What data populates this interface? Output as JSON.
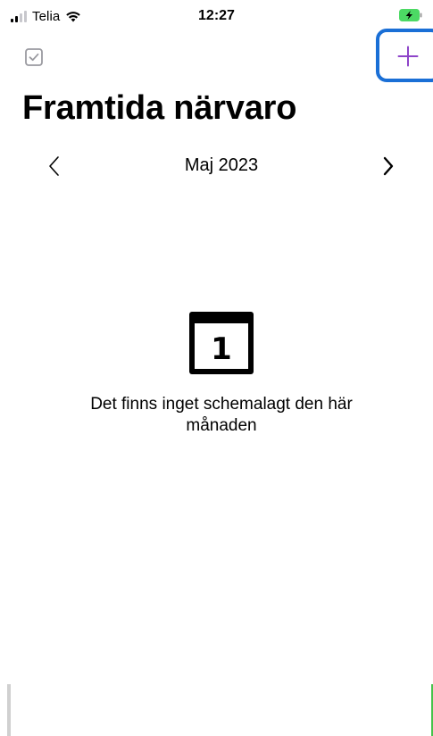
{
  "status_bar": {
    "carrier": "Telia",
    "time": "12:27",
    "signal_icon": "signal-bars-icon",
    "wifi_icon": "wifi-icon",
    "battery_icon": "battery-charging-icon",
    "battery_color": "#4cd964"
  },
  "header": {
    "select_icon": "checkbox-icon",
    "add_icon": "plus-icon",
    "accent_color": "#8e44c9",
    "highlight_color": "#1a6fd6"
  },
  "page": {
    "title": "Framtida närvaro"
  },
  "month_nav": {
    "prev_icon": "chevron-left-icon",
    "month": "Maj 2023",
    "next_icon": "chevron-right-icon"
  },
  "empty_state": {
    "icon": "calendar-icon",
    "day_number": "1",
    "message": "Det finns inget schemalagt den här månaden"
  }
}
